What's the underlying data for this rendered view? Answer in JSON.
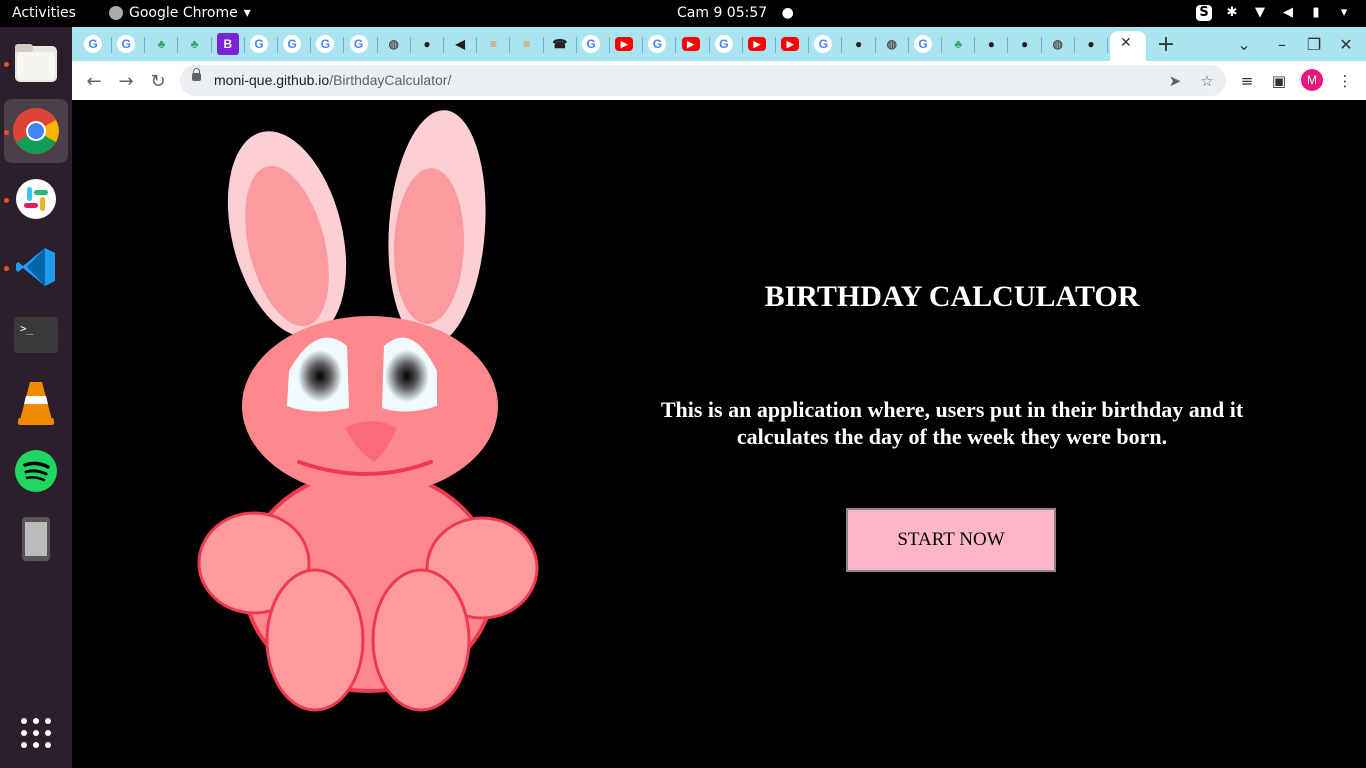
{
  "system_bar": {
    "activities": "Activities",
    "app_name": "Google Chrome",
    "clock": "Cam 9  05:57"
  },
  "dock": {
    "items": [
      "files-icon",
      "chrome-icon",
      "slack-icon",
      "vscode-icon",
      "terminal-icon",
      "vlc-icon",
      "spotify-icon",
      "phone-icon",
      "app-grid-icon"
    ]
  },
  "tabs": {
    "favicons": [
      "G",
      "G",
      "tree",
      "tree",
      "B",
      "G",
      "G",
      "G",
      "G",
      "globe",
      "github",
      "speaker",
      "stack",
      "stack",
      "phone",
      "G",
      "youtube",
      "G",
      "youtube",
      "G",
      "youtube",
      "youtube",
      "G",
      "github",
      "globe",
      "G",
      "tree",
      "github",
      "github",
      "globe",
      "github"
    ],
    "active_close": "✕",
    "new_tab": "+"
  },
  "address_bar": {
    "domain": "moni-que.github.io",
    "path": "/BirthdayCalculator/"
  },
  "profile": {
    "initial": "M",
    "color": "#e8177d"
  },
  "page": {
    "title": "BIRTHDAY CALCULATOR",
    "description": "This is an application where, users put in their birthday and it calculates the day of the week they were born.",
    "start_button": "START NOW",
    "button_color": "#ffb6c8",
    "background": "#000000"
  }
}
